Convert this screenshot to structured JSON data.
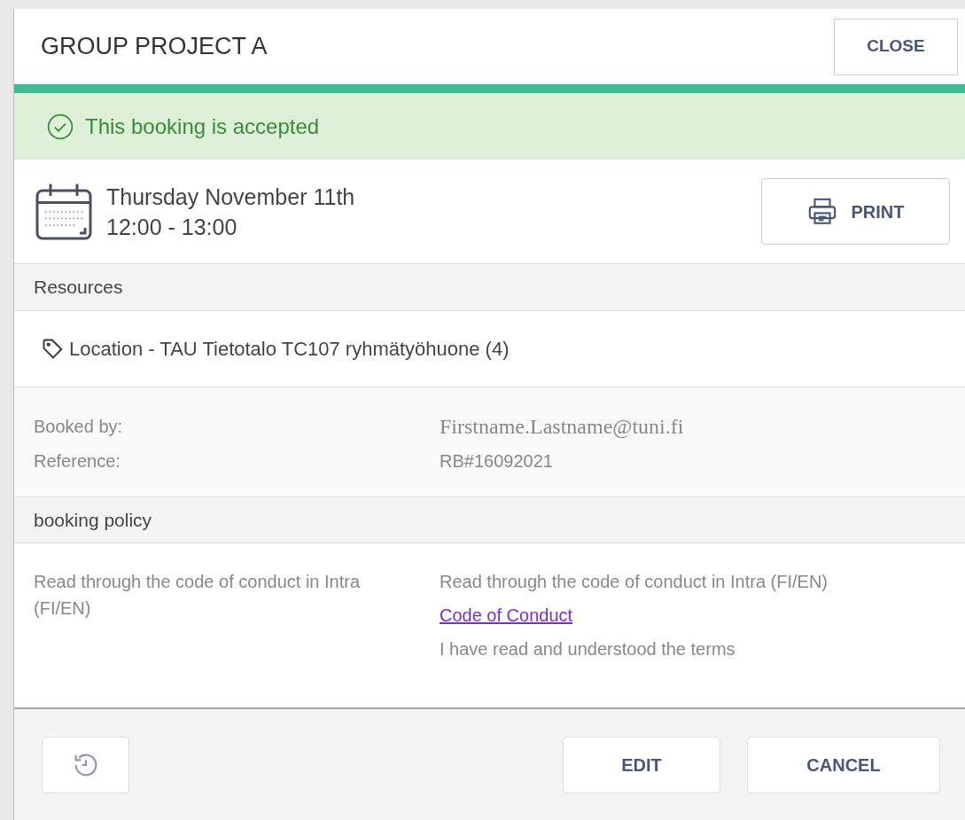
{
  "dialog": {
    "title": "GROUP PROJECT A",
    "close_label": "CLOSE"
  },
  "status": {
    "kind": "accepted",
    "text": "This booking is accepted"
  },
  "when": {
    "date": "Thursday November 11th",
    "time": "12:00 - 13:00",
    "print_label": "PRINT"
  },
  "resources": {
    "heading": "Resources",
    "items": [
      "Location - TAU Tietotalo TC107 ryhmätyöhuone (4)"
    ]
  },
  "details": [
    {
      "label": "Booked by:",
      "value": "Firstname.Lastname@tuni.fi",
      "kind": "serif"
    },
    {
      "label": "Reference:",
      "value": "RB#16092021",
      "kind": "plain"
    }
  ],
  "policy": {
    "heading": "booking policy",
    "name": "Read through the code of conduct in Intra (FI/EN)",
    "description": "Read through the code of conduct in Intra (FI/EN)",
    "link": "Code of Conduct",
    "acceptance": "I have read and understood the terms"
  },
  "footer": {
    "buttons": [
      "EDIT",
      "CANCEL"
    ]
  }
}
